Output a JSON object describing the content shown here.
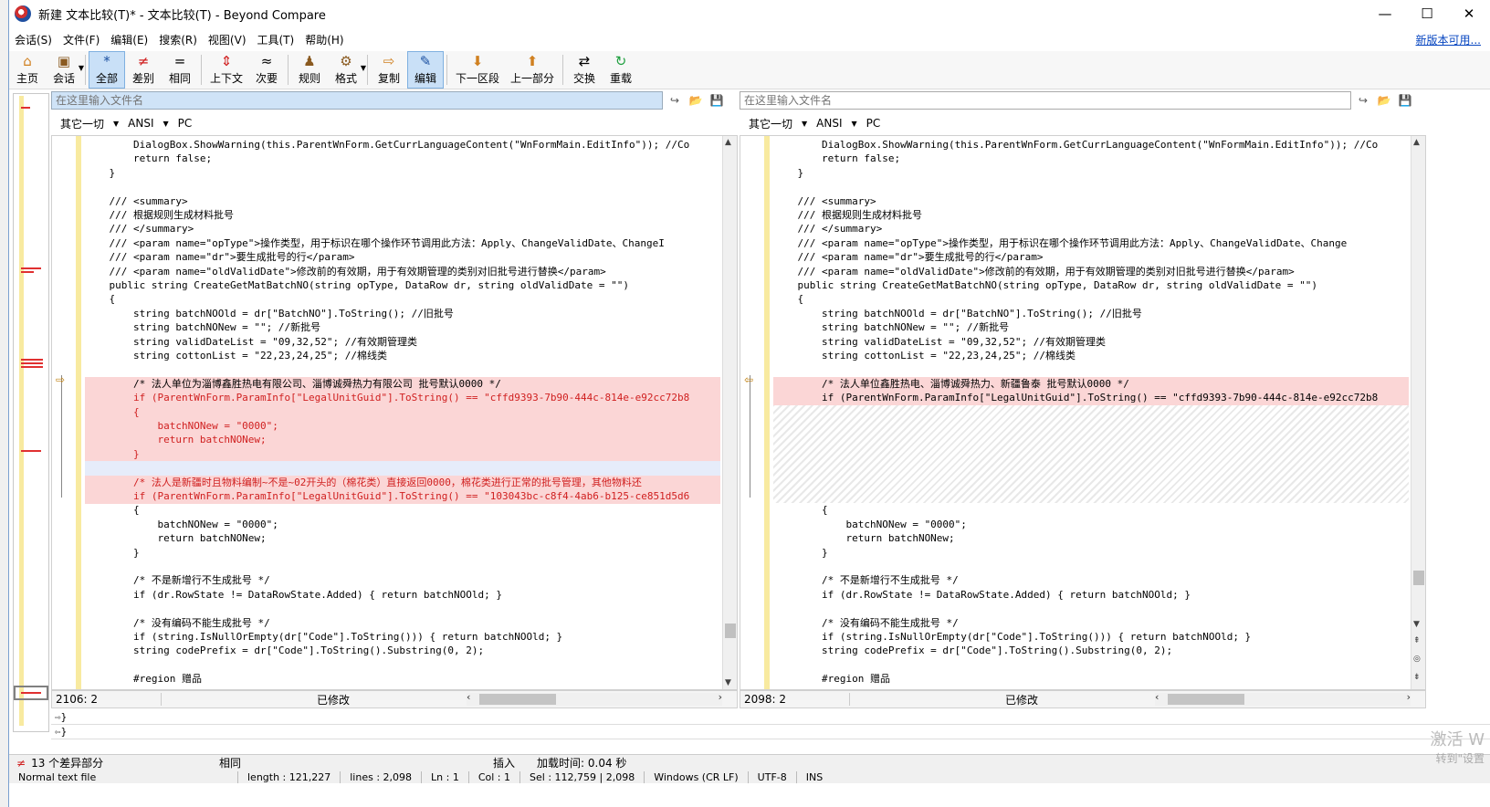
{
  "window": {
    "title": "新建 文本比较(T)* - 文本比较(T) - Beyond Compare",
    "controls": [
      "—",
      "☐",
      "✕"
    ]
  },
  "menu": {
    "items": [
      "会话(S)",
      "文件(F)",
      "编辑(E)",
      "搜索(R)",
      "视图(V)",
      "工具(T)",
      "帮助(H)"
    ],
    "update_link": "新版本可用..."
  },
  "toolbar": {
    "home": "主页",
    "session": "会话",
    "all": "全部",
    "diffs": "差别",
    "same": "相同",
    "context": "上下文",
    "minor": "次要",
    "rules": "规则",
    "format": "格式",
    "copy": "复制",
    "edit": "编辑",
    "next_section": "下一区段",
    "prev_section": "上一部分",
    "swap": "交换",
    "reload": "重载"
  },
  "left": {
    "path_placeholder": "在这里输入文件名",
    "fmt": [
      "其它一切",
      "ANSI",
      "PC"
    ],
    "status_pos": "2106: 2",
    "status_mod": "已修改",
    "lines": [
      "        DialogBox.ShowWarning(this.ParentWnForm.GetCurrLanguageContent(\"WnFormMain.EditInfo\")); //Co",
      "        return false;",
      "    }",
      "",
      "    /// <summary>",
      "    /// 根据规则生成材料批号",
      "    /// </summary>",
      "    /// <param name=\"opType\">操作类型，用于标识在哪个操作环节调用此方法：Apply、ChangeValidDate、ChangeI",
      "    /// <param name=\"dr\">要生成批号的行</param>",
      "    /// <param name=\"oldValidDate\">修改前的有效期，用于有效期管理的类别对旧批号进行替换</param>",
      "    public string CreateGetMatBatchNO(string opType, DataRow dr, string oldValidDate = \"\")",
      "    {",
      "        string batchNOOld = dr[\"BatchNO\"].ToString(); //旧批号",
      "        string batchNONew = \"\"; //新批号",
      "        string validDateList = \"09,32,52\"; //有效期管理类",
      "        string cottonList = \"22,23,24,25\"; //棉线类",
      "",
      "        /* 法人单位为淄博鑫胜热电有限公司、淄博诚舜热力有限公司 批号默认0000 */",
      "        if (ParentWnForm.ParamInfo[\"LegalUnitGuid\"].ToString() == \"cffd9393-7b90-444c-814e-e92cc72b8",
      "        {",
      "            batchNONew = \"0000\";",
      "            return batchNONew;",
      "        }",
      "",
      "        /* 法人是新疆时且物料编制~不是~02开头的（棉花类）直接返回0000，棉花类进行正常的批号管理，其他物料还",
      "        if (ParentWnForm.ParamInfo[\"LegalUnitGuid\"].ToString() == \"103043bc-c8f4-4ab6-b125-ce851d5d6",
      "        {",
      "            batchNONew = \"0000\";",
      "            return batchNONew;",
      "        }",
      "",
      "        /* 不是新增行不生成批号 */",
      "        if (dr.RowState != DataRowState.Added) { return batchNOOld; }",
      "",
      "        /* 没有编码不能生成批号 */",
      "        if (string.IsNullOrEmpty(dr[\"Code\"].ToString())) { return batchNOOld; }",
      "        string codePrefix = dr[\"Code\"].ToString().Substring(0, 2);",
      "",
      "        #region 赠品"
    ]
  },
  "right": {
    "path_placeholder": "在这里输入文件名",
    "fmt": [
      "其它一切",
      "ANSI",
      "PC"
    ],
    "status_pos": "2098: 2",
    "status_mod": "已修改",
    "lines_top": [
      "        DialogBox.ShowWarning(this.ParentWnForm.GetCurrLanguageContent(\"WnFormMain.EditInfo\")); //Co",
      "        return false;",
      "    }",
      "",
      "    /// <summary>",
      "    /// 根据规则生成材料批号",
      "    /// </summary>",
      "    /// <param name=\"opType\">操作类型，用于标识在哪个操作环节调用此方法：Apply、ChangeValidDate、Change",
      "    /// <param name=\"dr\">要生成批号的行</param>",
      "    /// <param name=\"oldValidDate\">修改前的有效期，用于有效期管理的类别对旧批号进行替换</param>",
      "    public string CreateGetMatBatchNO(string opType, DataRow dr, string oldValidDate = \"\")",
      "    {",
      "        string batchNOOld = dr[\"BatchNO\"].ToString(); //旧批号",
      "        string batchNONew = \"\"; //新批号",
      "        string validDateList = \"09,32,52\"; //有效期管理类",
      "        string cottonList = \"22,23,24,25\"; //棉线类",
      "",
      "        /* 法人单位鑫胜热电、淄博诚舜热力、新疆鲁泰 批号默认0000 */",
      "        if (ParentWnForm.ParamInfo[\"LegalUnitGuid\"].ToString() == \"cffd9393-7b90-444c-814e-e92cc72b8"
    ],
    "lines_bottom": [
      "        {",
      "            batchNONew = \"0000\";",
      "            return batchNONew;",
      "        }",
      "",
      "        /* 不是新增行不生成批号 */",
      "        if (dr.RowState != DataRowState.Added) { return batchNOOld; }",
      "",
      "        /* 没有编码不能生成批号 */",
      "        if (string.IsNullOrEmpty(dr[\"Code\"].ToString())) { return batchNOOld; }",
      "        string codePrefix = dr[\"Code\"].ToString().Substring(0, 2);",
      "",
      "        #region 赠品"
    ]
  },
  "merge": {
    "line1": "}",
    "line2": "}"
  },
  "status": {
    "diff_count": "13 个差异部分",
    "same": "相同",
    "insert": "插入",
    "load_time": "加载时间: 0.04 秒"
  },
  "editor_status": [
    "Normal text file",
    "length : 121,227",
    "lines : 2,098",
    "Ln : 1",
    "Col : 1",
    "Sel : 112,759 | 2,098",
    "Windows (CR LF)",
    "UTF-8",
    "INS"
  ],
  "watermark": {
    "line1": "激活 W",
    "line2": "转到\"设置"
  }
}
